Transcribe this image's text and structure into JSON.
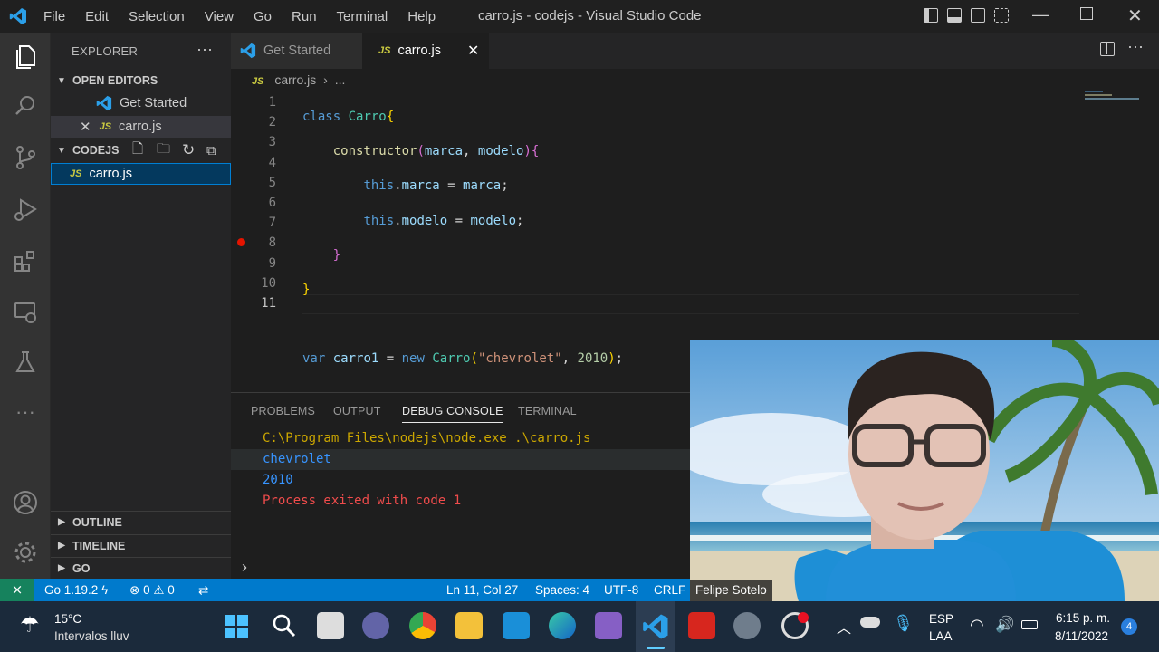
{
  "titlebar": {
    "menu": [
      "File",
      "Edit",
      "Selection",
      "View",
      "Go",
      "Run",
      "Terminal",
      "Help"
    ],
    "title": "carro.js - codejs - Visual Studio Code"
  },
  "sidebar": {
    "title": "EXPLORER",
    "open_editors": "OPEN EDITORS",
    "open_items": [
      "Get Started",
      "carro.js"
    ],
    "folder": "CODEJS",
    "files": [
      "carro.js"
    ],
    "outline": "OUTLINE",
    "timeline": "TIMELINE",
    "go": "GO"
  },
  "tabs": {
    "get_started": "Get Started",
    "carro": "carro.js"
  },
  "breadcrumb": {
    "file": "carro.js",
    "more": "..."
  },
  "editor": {
    "line_numbers": [
      "1",
      "2",
      "3",
      "4",
      "5",
      "6",
      "7",
      "8",
      "9",
      "10",
      "11"
    ]
  },
  "panel": {
    "tabs": [
      "PROBLEMS",
      "OUTPUT",
      "DEBUG CONSOLE",
      "TERMINAL"
    ],
    "output": [
      "C:\\Program Files\\nodejs\\node.exe .\\carro.js",
      "chevrolet",
      "2010",
      "Process exited with code 1"
    ]
  },
  "status": {
    "go": "Go 1.19.2",
    "errors": "0",
    "warnings": "0",
    "position": "Ln 11, Col 27",
    "spaces": "Spaces: 4",
    "encoding": "UTF-8",
    "eol": "CRLF"
  },
  "webcam": {
    "name": "Felipe Sotelo"
  },
  "taskbar": {
    "temp": "15°C",
    "weather": "Intervalos lluv",
    "lang1": "ESP",
    "lang2": "LAA",
    "time": "6:15 p. m.",
    "date": "8/11/2022",
    "notif": "4"
  },
  "colors": {
    "accent": "#007acc",
    "keyword": "#569cd6",
    "class": "#4ec9b0",
    "string": "#ce9178",
    "error": "#f14c4c"
  }
}
